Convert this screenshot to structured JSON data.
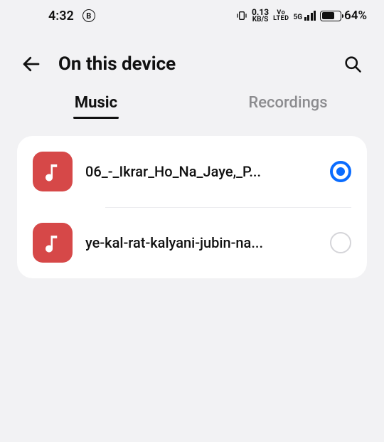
{
  "status": {
    "time": "4:32",
    "b_badge": "B",
    "data_rate_value": "0.13",
    "data_rate_unit": "KB/S",
    "volte_top": "Vo",
    "volte_bottom": "LTED",
    "network_gen": "5G",
    "battery_pct": "64%"
  },
  "header": {
    "title": "On this device"
  },
  "tabs": {
    "music": "Music",
    "recordings": "Recordings",
    "active_index": 0
  },
  "tracks": [
    {
      "name": "06_-_Ikrar_Ho_Na_Jaye,_P...",
      "selected": true
    },
    {
      "name": "ye-kal-rat-kalyani-jubin-na...",
      "selected": false
    }
  ],
  "colors": {
    "music_icon_bg": "#d64848",
    "radio_selected": "#0a6cff"
  }
}
